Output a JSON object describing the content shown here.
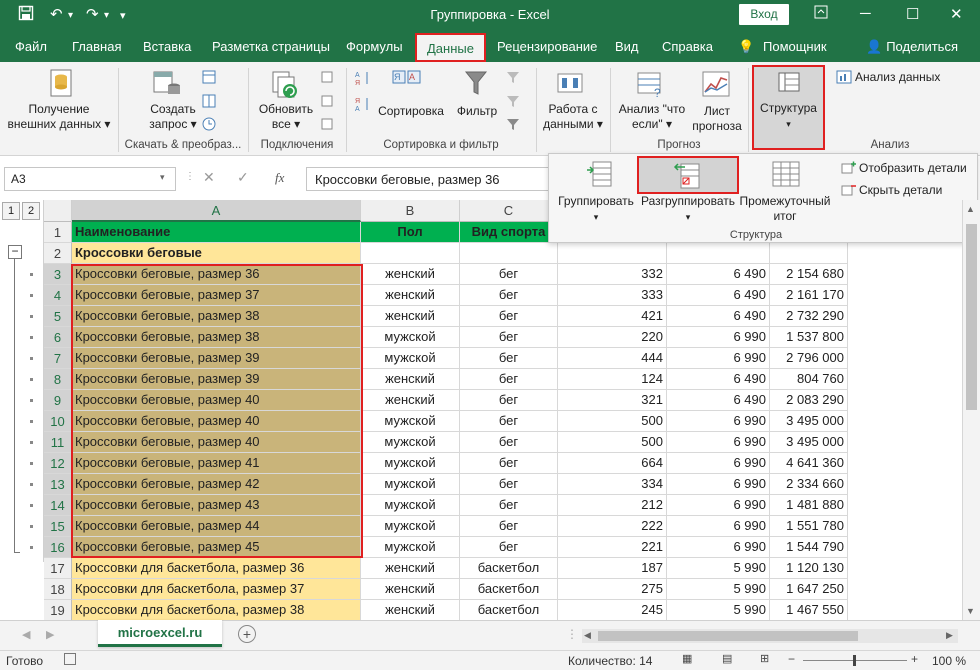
{
  "window": {
    "title": "Группировка - Excel",
    "login_label": "Вход"
  },
  "menu": {
    "tabs": [
      "Файл",
      "Главная",
      "Вставка",
      "Разметка страницы",
      "Формулы",
      "Данные",
      "Рецензирование",
      "Вид",
      "Справка",
      "Помощник"
    ],
    "active_tab": "Данные",
    "share_label": "Поделиться"
  },
  "ribbon": {
    "get_data": "Получение внешних данных",
    "create_query": "Создать запрос",
    "refresh_all": "Обновить все",
    "sort": "Сортировка",
    "filter": "Фильтр",
    "data_tools": "Работа с данными",
    "whatif": "Анализ \"что если\"",
    "forecast_sheet": "Лист прогноза",
    "outline": "Структура",
    "data_analysis": "Анализ данных",
    "groups": {
      "get_transform": "Скачать & преобраз...",
      "connections": "Подключения",
      "sort_filter": "Сортировка и фильтр",
      "forecast": "Прогноз",
      "analysis": "Анализ"
    }
  },
  "outline_panel": {
    "group": "Группировать",
    "ungroup": "Разгруппировать",
    "subtotal": "Промежуточный итог",
    "show_detail": "Отобразить детали",
    "hide_detail": "Скрыть детали",
    "label": "Структура"
  },
  "formula_bar": {
    "name_box": "A3",
    "formula": "Кроссовки беговые, размер 36",
    "fx": "fx"
  },
  "grid": {
    "outline_levels": [
      "1",
      "2"
    ],
    "column_headers": [
      "A",
      "B",
      "C"
    ],
    "rows": [
      {
        "n": "1",
        "a": "Наименование",
        "b": "Пол",
        "c": "Вид спорта",
        "d": "",
        "e": "",
        "f": "",
        "kind": "header"
      },
      {
        "n": "2",
        "a": "Кроссовки беговые",
        "b": "",
        "c": "",
        "d": "",
        "e": "",
        "f": "",
        "kind": "group"
      },
      {
        "n": "3",
        "a": "Кроссовки беговые, размер 36",
        "b": "женский",
        "c": "бег",
        "d": "332",
        "e": "6 490",
        "f": "2 154 680",
        "kind": "sel"
      },
      {
        "n": "4",
        "a": "Кроссовки беговые, размер 37",
        "b": "женский",
        "c": "бег",
        "d": "333",
        "e": "6 490",
        "f": "2 161 170",
        "kind": "sel"
      },
      {
        "n": "5",
        "a": "Кроссовки беговые, размер 38",
        "b": "женский",
        "c": "бег",
        "d": "421",
        "e": "6 490",
        "f": "2 732 290",
        "kind": "sel"
      },
      {
        "n": "6",
        "a": "Кроссовки беговые, размер 38",
        "b": "мужской",
        "c": "бег",
        "d": "220",
        "e": "6 990",
        "f": "1 537 800",
        "kind": "sel"
      },
      {
        "n": "7",
        "a": "Кроссовки беговые, размер 39",
        "b": "мужской",
        "c": "бег",
        "d": "444",
        "e": "6 990",
        "f": "2 796 000",
        "kind": "sel"
      },
      {
        "n": "8",
        "a": "Кроссовки беговые, размер 39",
        "b": "женский",
        "c": "бег",
        "d": "124",
        "e": "6 490",
        "f": "804 760",
        "kind": "sel"
      },
      {
        "n": "9",
        "a": "Кроссовки беговые, размер 40",
        "b": "женский",
        "c": "бег",
        "d": "321",
        "e": "6 490",
        "f": "2 083 290",
        "kind": "sel"
      },
      {
        "n": "10",
        "a": "Кроссовки беговые, размер 40",
        "b": "мужской",
        "c": "бег",
        "d": "500",
        "e": "6 990",
        "f": "3 495 000",
        "kind": "sel"
      },
      {
        "n": "11",
        "a": "Кроссовки беговые, размер 40",
        "b": "мужской",
        "c": "бег",
        "d": "500",
        "e": "6 990",
        "f": "3 495 000",
        "kind": "sel"
      },
      {
        "n": "12",
        "a": "Кроссовки беговые, размер 41",
        "b": "мужской",
        "c": "бег",
        "d": "664",
        "e": "6 990",
        "f": "4 641 360",
        "kind": "sel"
      },
      {
        "n": "13",
        "a": "Кроссовки беговые, размер 42",
        "b": "мужской",
        "c": "бег",
        "d": "334",
        "e": "6 990",
        "f": "2 334 660",
        "kind": "sel"
      },
      {
        "n": "14",
        "a": "Кроссовки беговые, размер 43",
        "b": "мужской",
        "c": "бег",
        "d": "212",
        "e": "6 990",
        "f": "1 481 880",
        "kind": "sel"
      },
      {
        "n": "15",
        "a": "Кроссовки беговые, размер 44",
        "b": "мужской",
        "c": "бег",
        "d": "222",
        "e": "6 990",
        "f": "1 551 780",
        "kind": "sel"
      },
      {
        "n": "16",
        "a": "Кроссовки беговые, размер 45",
        "b": "мужской",
        "c": "бег",
        "d": "221",
        "e": "6 990",
        "f": "1 544 790",
        "kind": "sel"
      },
      {
        "n": "17",
        "a": "Кроссовки для баскетбола, размер 36",
        "b": "женский",
        "c": "баскетбол",
        "d": "187",
        "e": "5 990",
        "f": "1 120 130",
        "kind": "normal"
      },
      {
        "n": "18",
        "a": "Кроссовки для баскетбола, размер 37",
        "b": "женский",
        "c": "баскетбол",
        "d": "275",
        "e": "5 990",
        "f": "1 647 250",
        "kind": "normal"
      },
      {
        "n": "19",
        "a": "Кроссовки для баскетбола, размер 38",
        "b": "женский",
        "c": "баскетбол",
        "d": "245",
        "e": "5 990",
        "f": "1 467 550",
        "kind": "normal"
      }
    ]
  },
  "sheet_tab": "microexcel.ru",
  "status": {
    "ready": "Готово",
    "count": "Количество: 14",
    "zoom": "100 %"
  },
  "colors": {
    "excel_green": "#217346",
    "highlight_red": "#e02020",
    "header_fill": "#00b050",
    "group_fill": "#ffe699",
    "selection_fill": "#c9b47a"
  }
}
